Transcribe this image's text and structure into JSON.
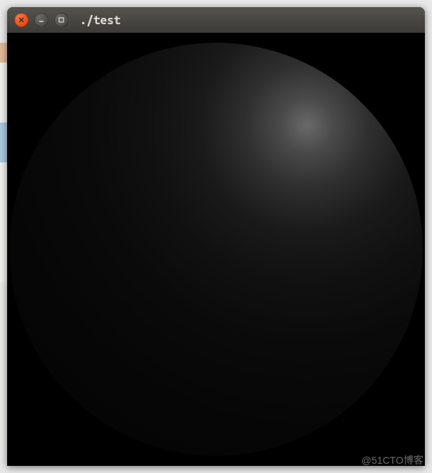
{
  "window": {
    "title": "./test",
    "controls": {
      "close": "close",
      "minimize": "minimize",
      "maximize": "maximize"
    }
  },
  "content": {
    "render": {
      "type": "sphere",
      "lighting": "top-right",
      "background_color": "#000000"
    }
  },
  "watermark": "@51CTO博客"
}
